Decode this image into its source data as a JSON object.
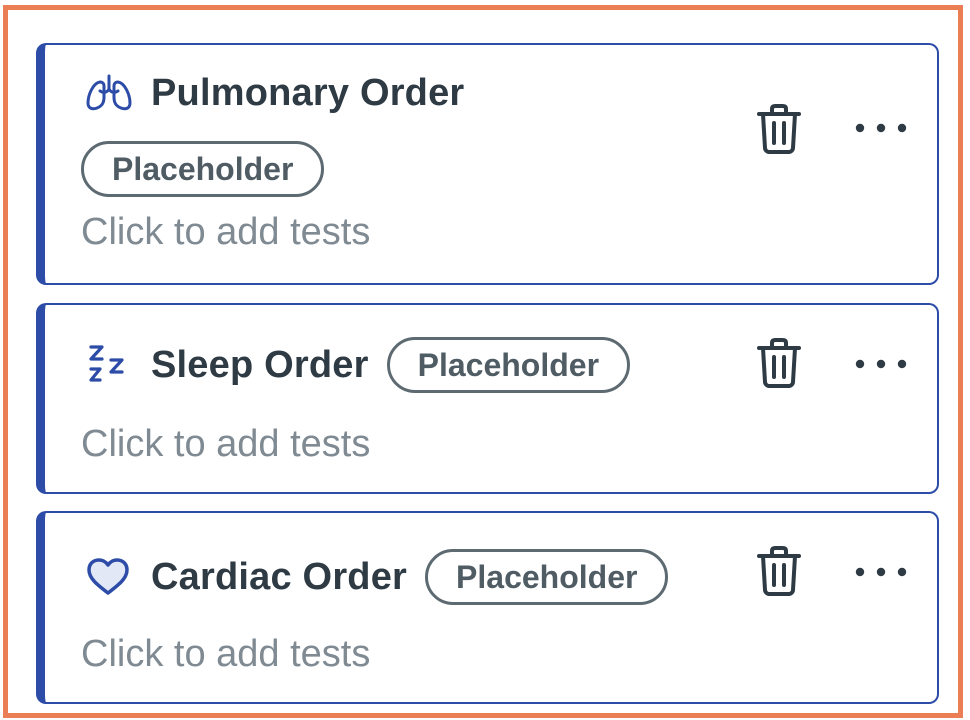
{
  "orders": [
    {
      "title": "Pulmonary Order",
      "icon": "lungs-icon",
      "badge": "Placeholder",
      "subtitle": "Click to add tests"
    },
    {
      "title": "Sleep Order",
      "icon": "sleep-zzz-icon",
      "badge": "Placeholder",
      "subtitle": "Click to add tests"
    },
    {
      "title": "Cardiac Order",
      "icon": "heart-icon",
      "badge": "Placeholder",
      "subtitle": "Click to add tests"
    }
  ],
  "actions": {
    "delete_icon": "trash-icon",
    "more_icon": "more-horizontal-icon"
  },
  "colors": {
    "frame_border": "#ec7e55",
    "card_accent": "#2c4ca8",
    "title_text": "#2f3b44",
    "badge_border": "#5d6a72",
    "subtitle_text": "#7f8a92",
    "icon_action": "#2f3b44"
  }
}
